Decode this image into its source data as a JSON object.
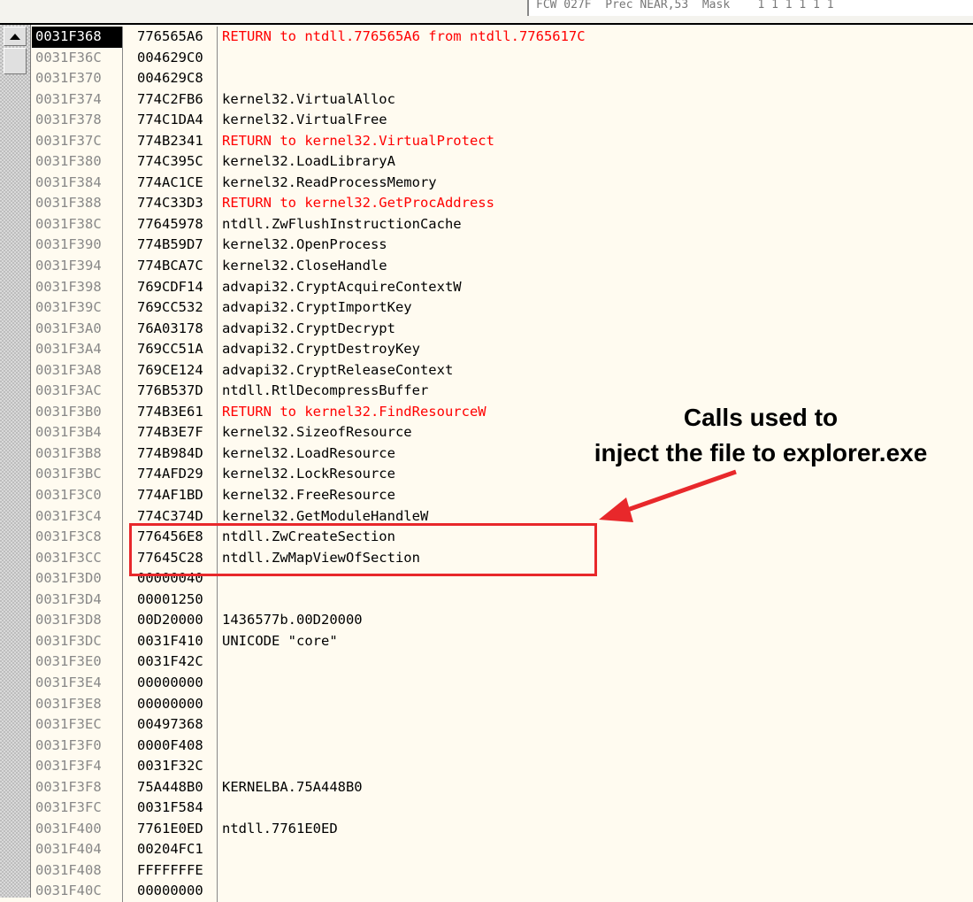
{
  "fpu_status": "FCW 027F  Prec NEAR,53  Mask    1 1 1 1 1 1",
  "annotation": {
    "line1": "Calls used to",
    "line2": "inject the file to explorer.exe",
    "color": "#e8282b"
  },
  "icons": {
    "scroll_up": "triangle-up-icon"
  },
  "stack": [
    {
      "addr": "0031F368",
      "val": "776565A6",
      "cmt": "RETURN to ntdll.776565A6 from ntdll.7765617C",
      "red": true,
      "sel": true
    },
    {
      "addr": "0031F36C",
      "val": "004629C0",
      "cmt": ""
    },
    {
      "addr": "0031F370",
      "val": "004629C8",
      "cmt": ""
    },
    {
      "addr": "0031F374",
      "val": "774C2FB6",
      "cmt": "kernel32.VirtualAlloc"
    },
    {
      "addr": "0031F378",
      "val": "774C1DA4",
      "cmt": "kernel32.VirtualFree"
    },
    {
      "addr": "0031F37C",
      "val": "774B2341",
      "cmt": "RETURN to kernel32.VirtualProtect",
      "red": true
    },
    {
      "addr": "0031F380",
      "val": "774C395C",
      "cmt": "kernel32.LoadLibraryA"
    },
    {
      "addr": "0031F384",
      "val": "774AC1CE",
      "cmt": "kernel32.ReadProcessMemory"
    },
    {
      "addr": "0031F388",
      "val": "774C33D3",
      "cmt": "RETURN to kernel32.GetProcAddress",
      "red": true
    },
    {
      "addr": "0031F38C",
      "val": "77645978",
      "cmt": "ntdll.ZwFlushInstructionCache"
    },
    {
      "addr": "0031F390",
      "val": "774B59D7",
      "cmt": "kernel32.OpenProcess"
    },
    {
      "addr": "0031F394",
      "val": "774BCA7C",
      "cmt": "kernel32.CloseHandle"
    },
    {
      "addr": "0031F398",
      "val": "769CDF14",
      "cmt": "advapi32.CryptAcquireContextW"
    },
    {
      "addr": "0031F39C",
      "val": "769CC532",
      "cmt": "advapi32.CryptImportKey"
    },
    {
      "addr": "0031F3A0",
      "val": "76A03178",
      "cmt": "advapi32.CryptDecrypt"
    },
    {
      "addr": "0031F3A4",
      "val": "769CC51A",
      "cmt": "advapi32.CryptDestroyKey"
    },
    {
      "addr": "0031F3A8",
      "val": "769CE124",
      "cmt": "advapi32.CryptReleaseContext"
    },
    {
      "addr": "0031F3AC",
      "val": "776B537D",
      "cmt": "ntdll.RtlDecompressBuffer"
    },
    {
      "addr": "0031F3B0",
      "val": "774B3E61",
      "cmt": "RETURN to kernel32.FindResourceW",
      "red": true
    },
    {
      "addr": "0031F3B4",
      "val": "774B3E7F",
      "cmt": "kernel32.SizeofResource"
    },
    {
      "addr": "0031F3B8",
      "val": "774B984D",
      "cmt": "kernel32.LoadResource"
    },
    {
      "addr": "0031F3BC",
      "val": "774AFD29",
      "cmt": "kernel32.LockResource"
    },
    {
      "addr": "0031F3C0",
      "val": "774AF1BD",
      "cmt": "kernel32.FreeResource"
    },
    {
      "addr": "0031F3C4",
      "val": "774C374D",
      "cmt": "kernel32.GetModuleHandleW"
    },
    {
      "addr": "0031F3C8",
      "val": "776456E8",
      "cmt": "ntdll.ZwCreateSection"
    },
    {
      "addr": "0031F3CC",
      "val": "77645C28",
      "cmt": "ntdll.ZwMapViewOfSection"
    },
    {
      "addr": "0031F3D0",
      "val": "00000040",
      "cmt": ""
    },
    {
      "addr": "0031F3D4",
      "val": "00001250",
      "cmt": ""
    },
    {
      "addr": "0031F3D8",
      "val": "00D20000",
      "cmt": "1436577b.00D20000"
    },
    {
      "addr": "0031F3DC",
      "val": "0031F410",
      "cmt": "UNICODE \"core\""
    },
    {
      "addr": "0031F3E0",
      "val": "0031F42C",
      "cmt": ""
    },
    {
      "addr": "0031F3E4",
      "val": "00000000",
      "cmt": ""
    },
    {
      "addr": "0031F3E8",
      "val": "00000000",
      "cmt": ""
    },
    {
      "addr": "0031F3EC",
      "val": "00497368",
      "cmt": ""
    },
    {
      "addr": "0031F3F0",
      "val": "0000F408",
      "cmt": ""
    },
    {
      "addr": "0031F3F4",
      "val": "0031F32C",
      "cmt": ""
    },
    {
      "addr": "0031F3F8",
      "val": "75A448B0",
      "cmt": "KERNELBA.75A448B0"
    },
    {
      "addr": "0031F3FC",
      "val": "0031F584",
      "cmt": ""
    },
    {
      "addr": "0031F400",
      "val": "7761E0ED",
      "cmt": "ntdll.7761E0ED"
    },
    {
      "addr": "0031F404",
      "val": "00204FC1",
      "cmt": ""
    },
    {
      "addr": "0031F408",
      "val": "FFFFFFFE",
      "cmt": ""
    },
    {
      "addr": "0031F40C",
      "val": "00000000",
      "cmt": ""
    }
  ]
}
